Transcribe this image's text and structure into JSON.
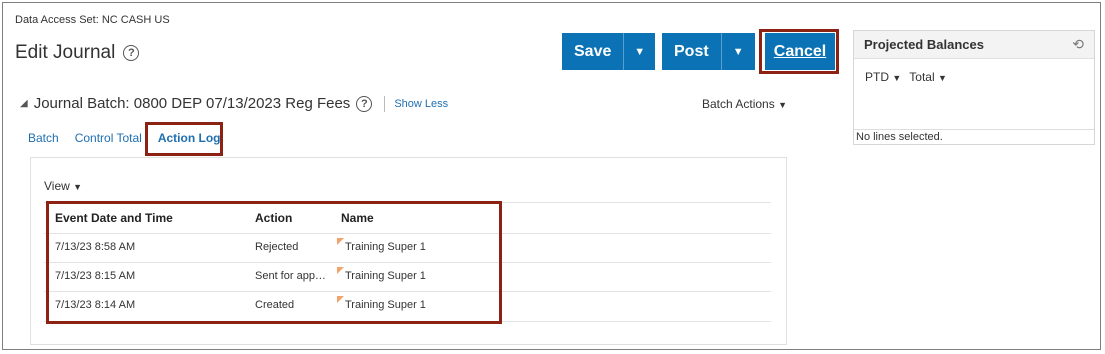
{
  "header": {
    "data_access_set": "Data Access Set: NC CASH US",
    "page_title": "Edit Journal"
  },
  "toolbar": {
    "save_label": "Save",
    "post_label": "Post",
    "cancel_label": "Cancel"
  },
  "batch": {
    "title": "Journal Batch: 0800 DEP 07/13/2023 Reg Fees",
    "show_less": "Show Less",
    "batch_actions": "Batch Actions"
  },
  "tabs": [
    {
      "label": "Batch"
    },
    {
      "label": "Control Total"
    },
    {
      "label": "Action Log"
    }
  ],
  "action_log": {
    "view_label": "View",
    "columns": [
      "Event Date and Time",
      "Action",
      "Name"
    ],
    "rows": [
      {
        "datetime": "7/13/23 8:58 AM",
        "action": "Rejected",
        "name": "Training Super 1"
      },
      {
        "datetime": "7/13/23 8:15 AM",
        "action": "Sent for app…",
        "name": "Training Super 1"
      },
      {
        "datetime": "7/13/23 8:14 AM",
        "action": "Created",
        "name": "Training Super 1"
      }
    ]
  },
  "projected_balances": {
    "title": "Projected Balances",
    "filter_ptd": "PTD",
    "filter_total": "Total",
    "empty_text": "No lines selected."
  },
  "colors": {
    "accent": "#0a72b5",
    "highlight": "#8b2214",
    "link": "#1f6fb0"
  }
}
